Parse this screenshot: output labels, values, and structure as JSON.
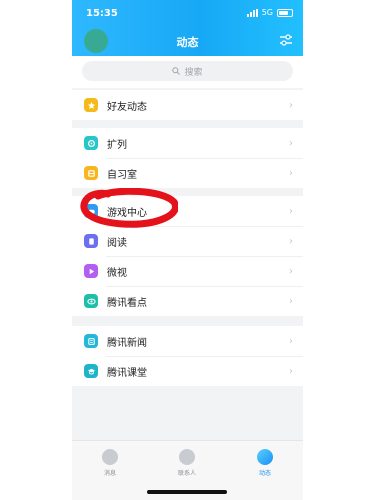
{
  "status_bar": {
    "time": "15:35",
    "network": "5G"
  },
  "header": {
    "title": "动态"
  },
  "search": {
    "placeholder": "搜索"
  },
  "groups": [
    {
      "items": [
        {
          "label": "好友动态",
          "icon": "friends-star-icon",
          "color": "#f5b91a"
        }
      ]
    },
    {
      "items": [
        {
          "label": "扩列",
          "icon": "expand-list-icon",
          "color": "#26c6c9"
        },
        {
          "label": "自习室",
          "icon": "study-room-icon",
          "color": "#f7b51e"
        }
      ]
    },
    {
      "items": [
        {
          "label": "游戏中心",
          "icon": "game-center-icon",
          "color": "#2c9cf3"
        },
        {
          "label": "阅读",
          "icon": "reading-icon",
          "color": "#6b6ff0"
        },
        {
          "label": "微视",
          "icon": "weishi-icon",
          "color": "#b25ef0"
        },
        {
          "label": "腾讯看点",
          "icon": "kandian-icon",
          "color": "#1ebfa8"
        }
      ]
    },
    {
      "items": [
        {
          "label": "腾讯新闻",
          "icon": "news-icon",
          "color": "#22b8d8"
        },
        {
          "label": "腾讯课堂",
          "icon": "classroom-icon",
          "color": "#1fb4c9"
        }
      ]
    }
  ],
  "tabbar": {
    "tabs": [
      {
        "label": "消息",
        "active": false
      },
      {
        "label": "联系人",
        "active": false
      },
      {
        "label": "动态",
        "active": true
      }
    ]
  },
  "colors": {
    "header": "#1aa9f6",
    "annotation": "#e3121b"
  }
}
